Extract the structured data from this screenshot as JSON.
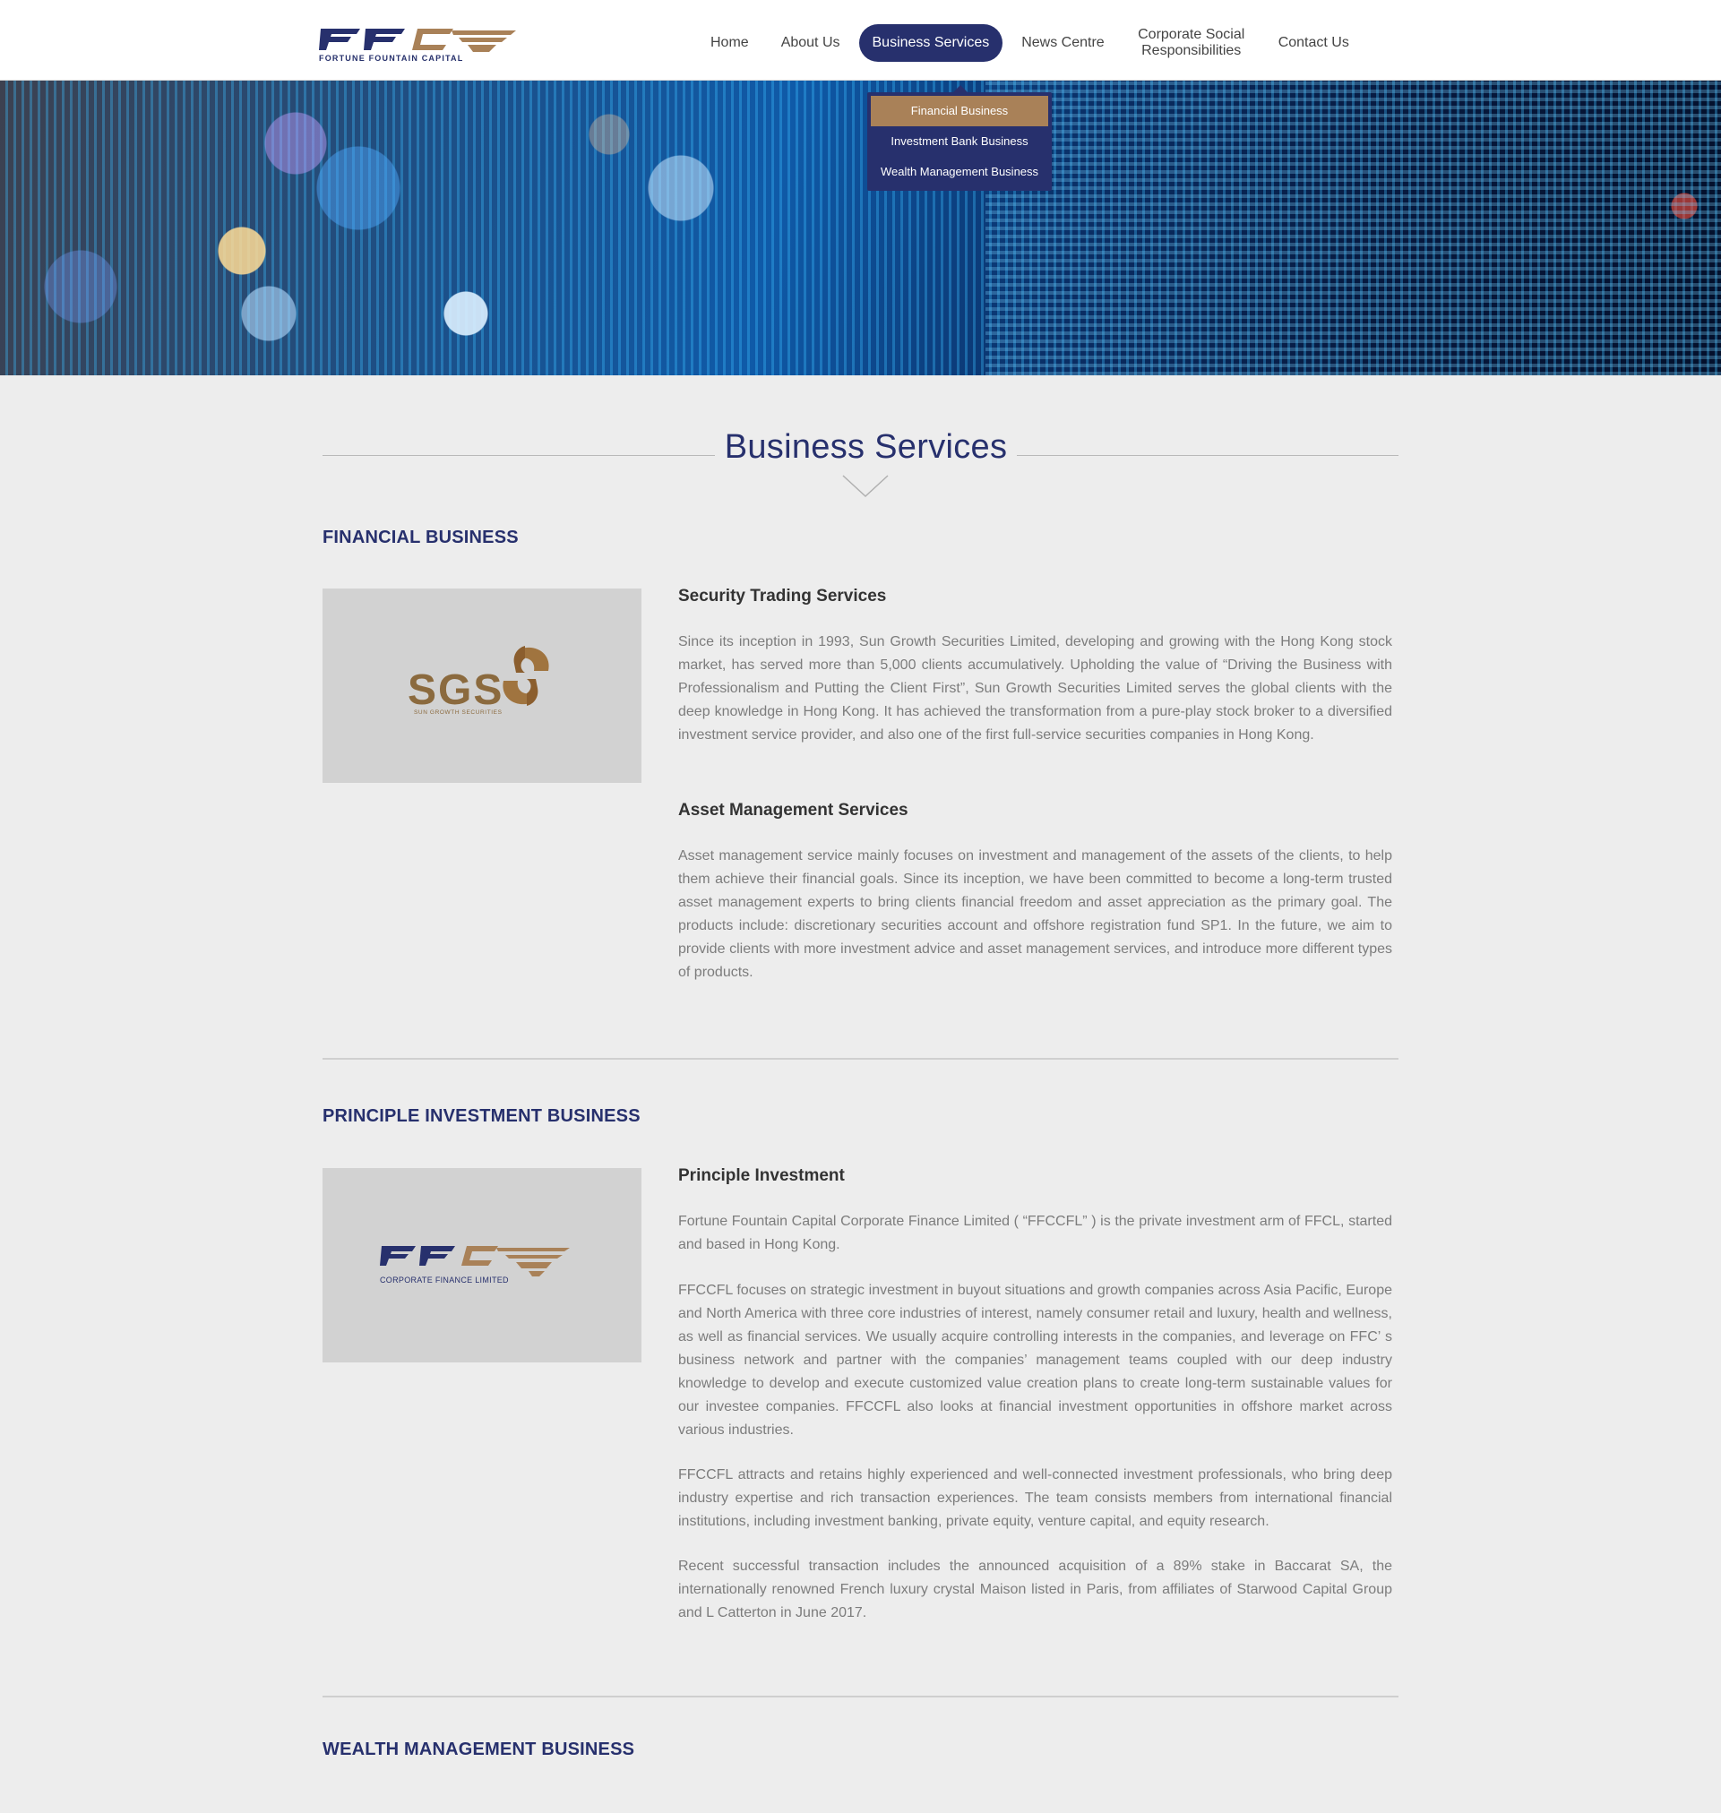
{
  "brand": {
    "logo_letters": "FFC",
    "logo_tagline": "FORTUNE FOUNTAIN CAPITAL",
    "navy": "#27306d",
    "bronze": "#a98158"
  },
  "nav": {
    "items": [
      {
        "label": "Home",
        "active": false
      },
      {
        "label": "About Us",
        "active": false
      },
      {
        "label": "Business Services",
        "active": true
      },
      {
        "label": "News Centre",
        "active": false
      },
      {
        "label": "Corporate Social Responsibilities",
        "active": false
      },
      {
        "label": "Contact Us",
        "active": false
      }
    ],
    "dropdown": [
      {
        "label": "Financial Business",
        "active": true
      },
      {
        "label": "Investment Bank Business",
        "active": false
      },
      {
        "label": "Wealth Management Business",
        "active": false
      }
    ]
  },
  "page": {
    "title": "Business Services"
  },
  "sections": {
    "financial": {
      "title": "FINANCIAL BUSINESS",
      "logo_letters": "SGS",
      "logo_caption": "SUN GROWTH SECURITIES",
      "sub1_title": "Security Trading Services",
      "sub1_text": "Since its inception in 1993, Sun Growth Securities Limited, developing and growing with the Hong Kong stock market, has served more than 5,000 clients accumulatively. Upholding the value of  “Driving the Business with Professionalism and Putting the Client First”, Sun Growth Securities Limited serves the global clients with the deep knowledge in Hong Kong. It has achieved the transformation from a pure-play stock broker to a diversified investment service provider, and also one of the first full-service securities companies in Hong Kong.",
      "sub2_title": "Asset Management Services",
      "sub2_text": "Asset management service mainly focuses on investment and management of the assets of the clients, to help them achieve their financial goals. Since its inception, we have been committed to become a long-term trusted asset management experts to bring clients financial freedom and asset appreciation as the primary goal. The products include: discretionary securities account and offshore registration fund SP1. In the future, we aim to provide clients with more investment advice and asset management services, and introduce more different types of products."
    },
    "principle": {
      "title": "PRINCIPLE INVESTMENT BUSINESS",
      "logo_letters": "FFC",
      "logo_caption": "CORPORATE FINANCE LIMITED",
      "sub_title": "Principle Investment",
      "p1": "Fortune Fountain Capital Corporate Finance Limited ( “FFCCFL” ) is the private investment arm of FFCL, started and based in Hong Kong.",
      "p2": " FFCCFL focuses on strategic investment in buyout situations and growth companies across Asia Pacific, Europe and North America with three core industries of interest, namely consumer retail and luxury, health and wellness, as well as financial services. We usually acquire controlling interests in the companies, and leverage on FFC’ s business network and partner with the companies’  management teams coupled with our deep industry knowledge to develop and execute customized value creation plans to create long-term sustainable values for our investee companies.  FFCCFL also looks at financial investment opportunities in offshore market across various industries.",
      "p3": " FFCCFL attracts and retains highly experienced and well-connected investment professionals, who bring deep industry expertise and rich transaction experiences. The team consists members from international financial institutions, including investment banking, private equity, venture capital, and equity research.",
      "p4": " Recent successful transaction includes the announced acquisition of a 89% stake in Baccarat SA, the internationally renowned French luxury crystal Maison listed in Paris, from affiliates of Starwood Capital Group and L Catterton in June 2017."
    },
    "wealth": {
      "title": "WEALTH MANAGEMENT BUSINESS"
    }
  }
}
